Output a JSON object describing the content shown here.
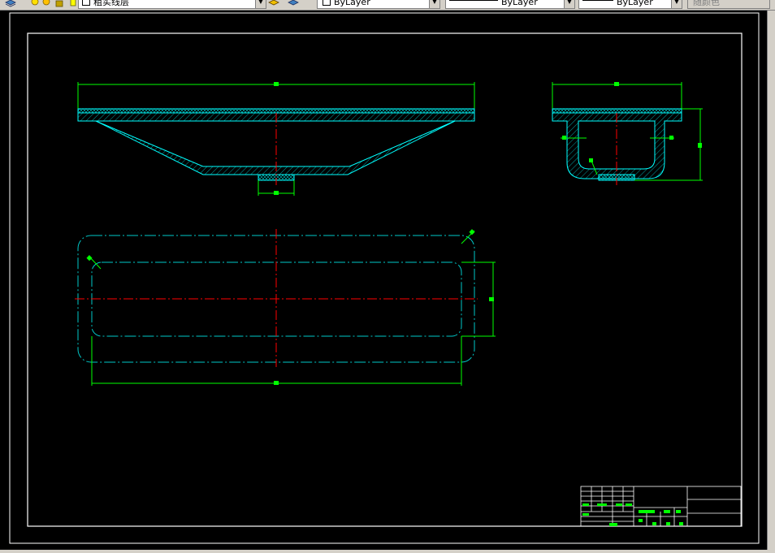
{
  "toolbar": {
    "layer_name": "粗实线层",
    "color_combo": "ByLayer",
    "linetype_combo": "ByLayer",
    "lineweight_combo": "ByLayer",
    "plotstyle_combo": "随颜色"
  },
  "colors": {
    "background": "#000000",
    "border": "#ffffff",
    "dimension": "#00ff00",
    "outline": "#00ffff",
    "centerline": "#ff0000",
    "hatch": "#00c8c8"
  },
  "drawing": {
    "views": [
      "front-view",
      "side-view",
      "top-view"
    ],
    "title_block": "title-block"
  }
}
